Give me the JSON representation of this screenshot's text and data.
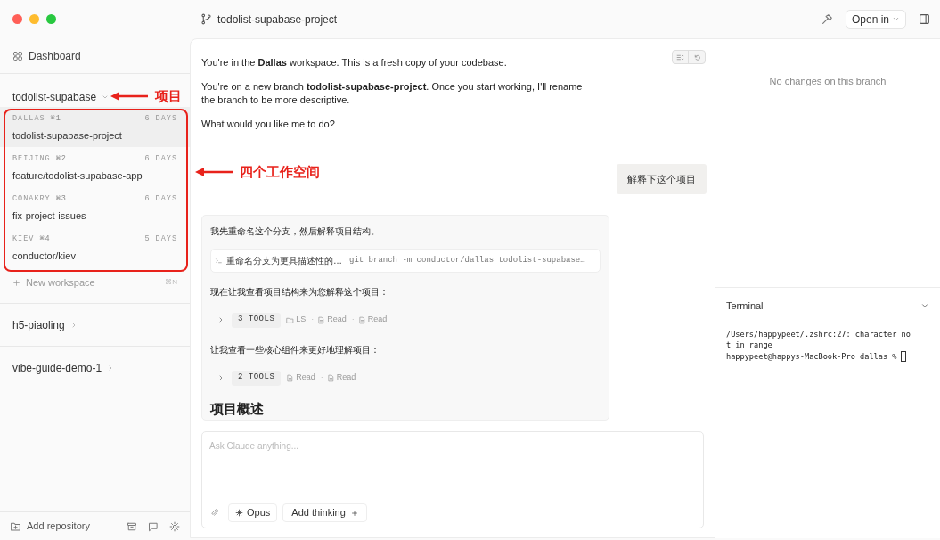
{
  "window": {
    "branch": "todolist-supabase-project",
    "open_in": "Open in"
  },
  "sidebar": {
    "dashboard": "Dashboard",
    "projects": [
      {
        "name": "todolist-supabase",
        "expanded": true,
        "workspaces": [
          {
            "city": "DALLAS",
            "shortcut": "⌘1",
            "age": "6 DAYS",
            "branch": "todolist-supabase-project",
            "selected": true
          },
          {
            "city": "BEIJING",
            "shortcut": "⌘2",
            "age": "6 DAYS",
            "branch": "feature/todolist-supabase-app",
            "selected": false
          },
          {
            "city": "CONAKRY",
            "shortcut": "⌘3",
            "age": "6 DAYS",
            "branch": "fix-project-issues",
            "selected": false
          },
          {
            "city": "KIEV",
            "shortcut": "⌘4",
            "age": "5 DAYS",
            "branch": "conductor/kiev",
            "selected": false
          }
        ],
        "new_workspace": {
          "label": "New workspace",
          "shortcut": "⌘N"
        }
      },
      {
        "name": "h5-piaoling",
        "expanded": false
      },
      {
        "name": "vibe-guide-demo-1",
        "expanded": false
      }
    ],
    "add_repository": "Add repository"
  },
  "chat": {
    "intro": [
      "You're in the **Dallas** workspace. This is a fresh copy of your codebase.",
      "You're on a new branch **todolist-supabase-project**. Once you start working, I'll rename the branch to be more descriptive.",
      "What would you like me to do?"
    ],
    "user_message": "解释下这个项目",
    "assistant": [
      {
        "kind": "text",
        "text": "我先重命名这个分支，然后解释项目结构。"
      },
      {
        "kind": "command",
        "title": "重命名分支为更具描述性的…",
        "command": "git branch -m conductor/dallas todolist-supabase…"
      },
      {
        "kind": "text",
        "text": "现在让我查看项目结构来为您解释这个项目："
      },
      {
        "kind": "tools",
        "count": "3 TOOLS",
        "separator": "·",
        "items": [
          {
            "kind": "folder",
            "label": "LS"
          },
          {
            "kind": "file",
            "label": "Read"
          },
          {
            "kind": "file",
            "label": "Read"
          }
        ]
      },
      {
        "kind": "text",
        "text": "让我查看一些核心组件来更好地理解项目："
      },
      {
        "kind": "tools",
        "count": "2 TOOLS",
        "separator": "·",
        "items": [
          {
            "kind": "file",
            "label": "Read"
          },
          {
            "kind": "file",
            "label": "Read"
          }
        ]
      },
      {
        "kind": "heading",
        "text": "项目概述"
      }
    ],
    "input": {
      "placeholder": "Ask Claude anything..."
    },
    "model": "Opus",
    "thinking": "Add thinking"
  },
  "changes": {
    "empty_text": "No changes on this branch"
  },
  "terminal": {
    "title": "Terminal",
    "lines": [
      "/Users/happypeet/.zshrc:27: character no",
      "t in range",
      "happypeet@happys-MacBook-Pro dallas %"
    ]
  },
  "annotations": [
    {
      "text": "项目"
    },
    {
      "text": "四个工作空间"
    }
  ]
}
